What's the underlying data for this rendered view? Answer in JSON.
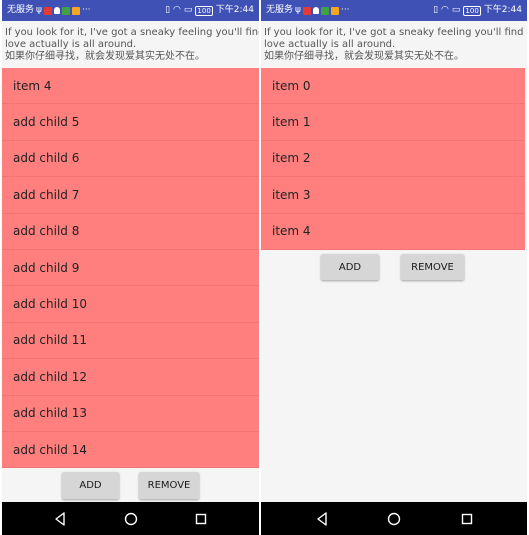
{
  "left_screen": {
    "status_bar": {
      "carrier": "无服务",
      "time": "下午2:44",
      "battery": "100"
    },
    "description": {
      "line1": "If you look for it, I've got a sneaky feeling you'll find that",
      "line2": "love actually is all around.",
      "line3": "如果你仔细寻找，就会发现爱其实无处不在。"
    },
    "list_items": [
      "item 4",
      "add child 5",
      "add child 6",
      "add child 7",
      "add child 8",
      "add child 9",
      "add child 10",
      "add child 11",
      "add child 12",
      "add child 13",
      "add child 14"
    ],
    "buttons": {
      "add_label": "ADD",
      "remove_label": "REMOVE"
    }
  },
  "right_screen": {
    "status_bar": {
      "carrier": "无服务",
      "time": "下午2:44",
      "battery": "100"
    },
    "description": {
      "line1": "If you look for it, I've got a sneaky feeling you'll find that",
      "line2": "love actually is all around.",
      "line3": "如果你仔细寻找，就会发现爱其实无处不在。"
    },
    "list_items": [
      "item 0",
      "item 1",
      "item 2",
      "item 3",
      "item 4"
    ],
    "buttons": {
      "add_label": "ADD",
      "remove_label": "REMOVE"
    }
  },
  "colors": {
    "status_bar": "#3f51b5",
    "list_item_bg": "#ff7f7f",
    "button_bg": "#d6d6d6",
    "nav_bar": "#000000"
  },
  "icons": {
    "nav": [
      "back-triangle-icon",
      "home-circle-icon",
      "recents-square-icon"
    ]
  }
}
